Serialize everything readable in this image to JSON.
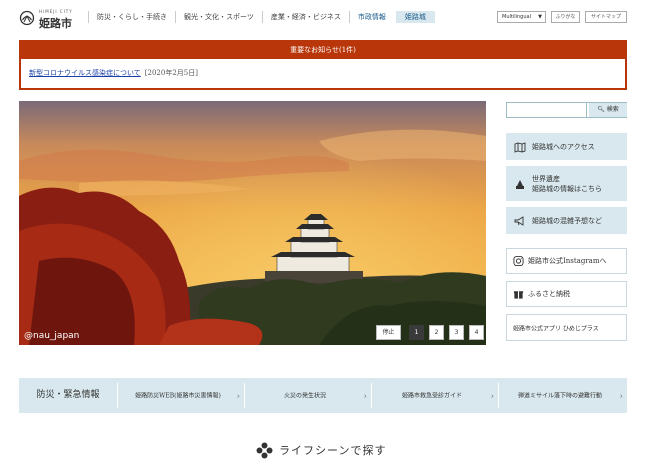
{
  "header": {
    "logo_en": "HIMEJI CITY",
    "logo_jp": "姫路市",
    "nav": [
      "防災・くらし・手続き",
      "観光・文化・スポーツ",
      "産業・経済・ビジネス",
      "市政情報",
      "姫路城"
    ],
    "language": "Multilingual",
    "hiragana_btn": "ふりがな",
    "sitemap_btn": "サイトマップ"
  },
  "alert": {
    "title": "重要なお知らせ(1件)",
    "link": "新型コロナウイルス感染症について",
    "date": "[2020年2月5日]"
  },
  "hero": {
    "credit": "@nau_japan",
    "stop_label": "停止",
    "pages": [
      "1",
      "2",
      "3",
      "4"
    ],
    "active_page": "1"
  },
  "sidebar": {
    "search_placeholder": "",
    "search_btn": "検索",
    "links": [
      {
        "icon": "map-icon",
        "label": "姫路城へのアクセス"
      },
      {
        "icon": "castle-icon",
        "label1": "世界遺産",
        "label2": "姫路城の情報はこちら"
      },
      {
        "icon": "megaphone-icon",
        "label": "姫路城の混雑予想など"
      }
    ],
    "instagram": "姫路市公式Instagramへ",
    "furusato": "ふるさと納税",
    "app": "姫路市公式アプリ ひめじプラス"
  },
  "disaster": {
    "title": "防災・緊急情報",
    "items": [
      "姫路防災WEB(姫路市災害情報)",
      "火災の発生状況",
      "姫路市救急受診ガイド",
      "弾道ミサイル落下時の避難行動"
    ]
  },
  "life": {
    "title": "ライフシーンで探す"
  },
  "colors": {
    "alert": "#b8360a",
    "panel": "#d8e8ee"
  }
}
